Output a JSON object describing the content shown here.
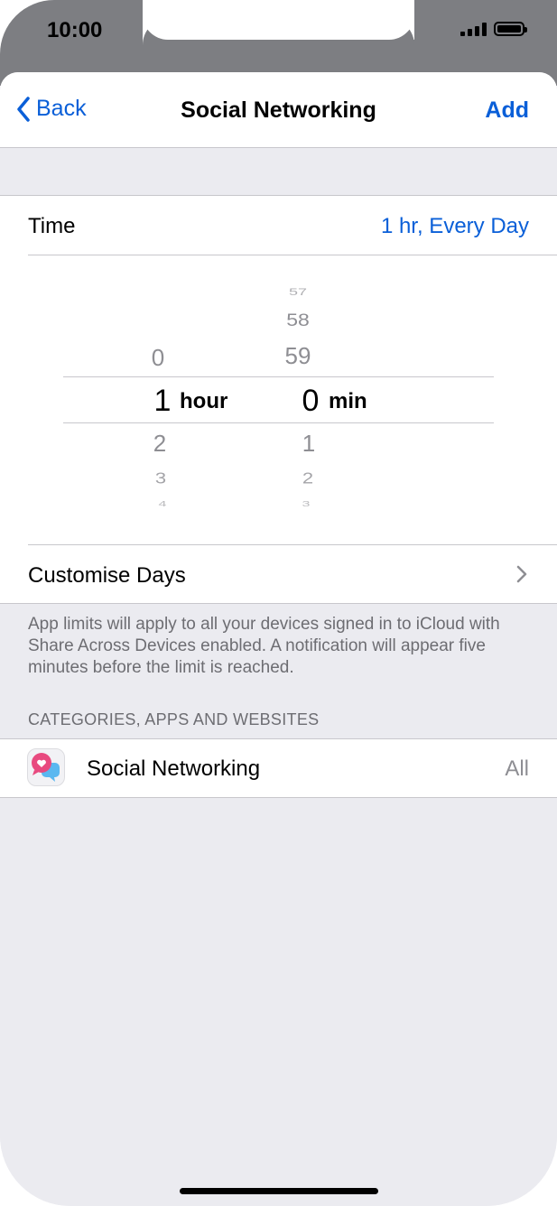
{
  "status_bar": {
    "time": "10:00"
  },
  "nav": {
    "back_label": "Back",
    "title": "Social Networking",
    "add_label": "Add"
  },
  "time_row": {
    "label": "Time",
    "value": "1 hr, Every Day"
  },
  "picker": {
    "hours": {
      "above": [
        "0"
      ],
      "selected": "1",
      "below": [
        "2",
        "3",
        "4"
      ],
      "unit": "hour"
    },
    "minutes": {
      "above": [
        "57",
        "58",
        "59"
      ],
      "selected": "0",
      "below": [
        "1",
        "2",
        "3"
      ],
      "unit": "min"
    }
  },
  "customise_row": {
    "label": "Customise Days"
  },
  "footnote": "App limits will apply to all your devices signed in to iCloud with Share Across Devices enabled. A notification will appear five minutes before the limit is reached.",
  "section_header": "CATEGORIES, APPS AND WEBSITES",
  "app_row": {
    "label": "Social Networking",
    "value": "All"
  },
  "colors": {
    "accent": "#0a5fd8",
    "secondary_text": "#8e8e93",
    "background": "#ebebf0",
    "icon_heart": "#e84a7f",
    "icon_bubble": "#5ab8f0"
  },
  "icons": {
    "back": "chevron-left",
    "disclosure": "chevron-right",
    "app": "social-networking-bubbles"
  }
}
